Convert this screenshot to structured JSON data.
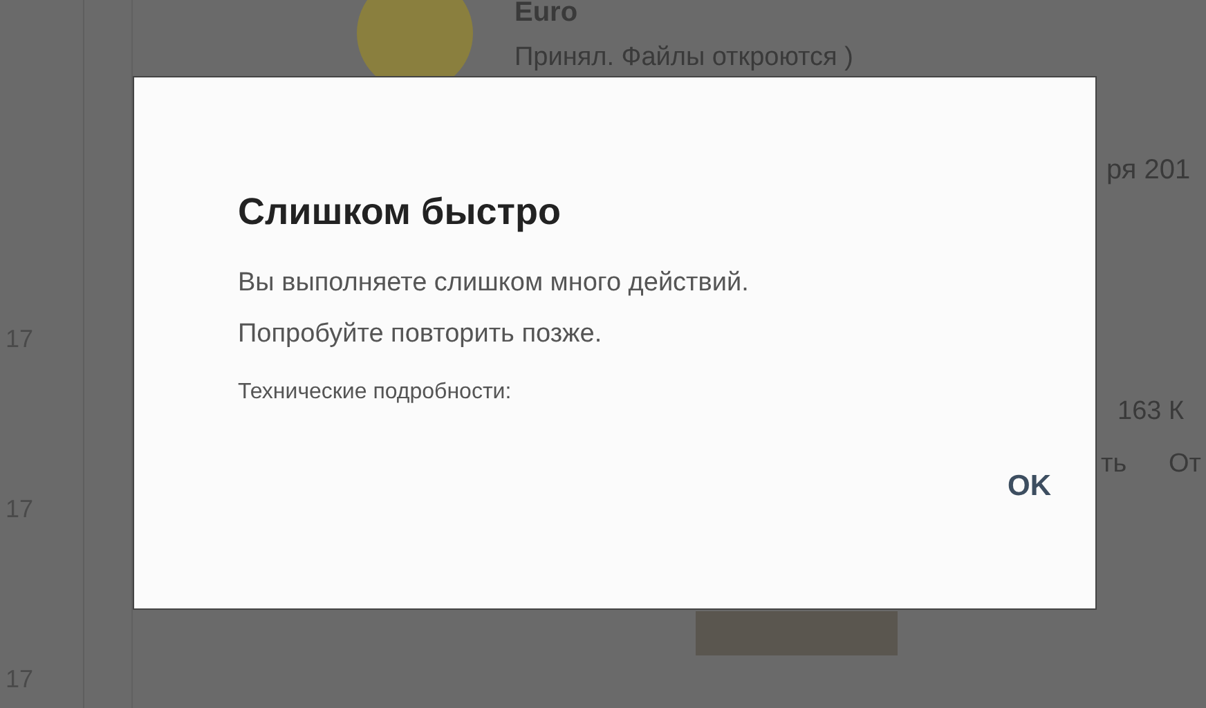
{
  "background": {
    "author": "Euro",
    "message": "Принял. Файлы откроются )",
    "date_fragment": "ря 201",
    "size_fragment": "163 К",
    "link_fragments": [
      "ть",
      "От"
    ],
    "times": [
      "17",
      "17",
      "17"
    ]
  },
  "dialog": {
    "title": "Слишком быстро",
    "lines": [
      "Вы выполняете слишком много действий.",
      "Попробуйте повторить позже."
    ],
    "details_label": "Технические подробности:",
    "button": "OK"
  }
}
